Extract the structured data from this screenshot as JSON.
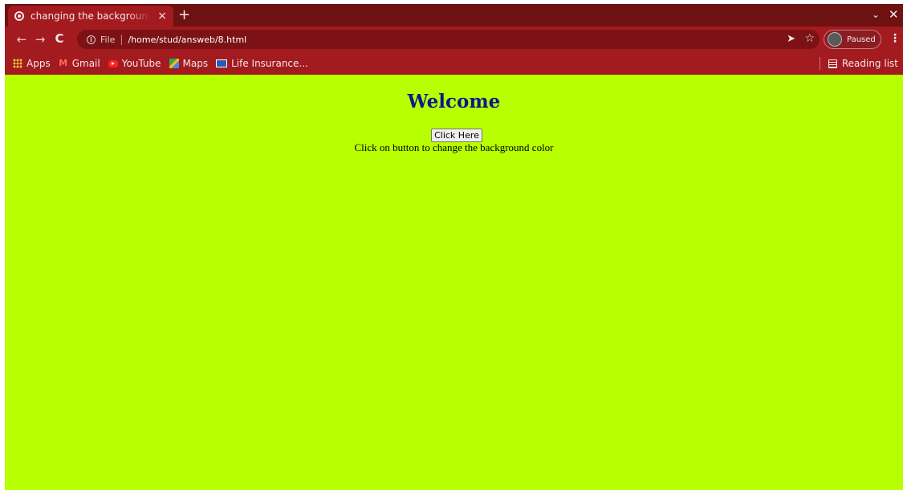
{
  "browser": {
    "tab": {
      "title": "changing the background color",
      "close": "×"
    },
    "new_tab": "+",
    "tab_dropdown": "⌄",
    "window_close": "✕",
    "nav": {
      "back": "←",
      "forward": "→",
      "reload": "C"
    },
    "omnibox": {
      "scheme_label": "File",
      "separator": "|",
      "url": "/home/stud/answeb/8.html"
    },
    "profile": {
      "status": "Paused"
    },
    "menu": "⋮",
    "bookmarks": [
      {
        "label": "Apps",
        "icon": "apps-grid-icon"
      },
      {
        "label": "Gmail",
        "icon": "gmail-icon"
      },
      {
        "label": "YouTube",
        "icon": "youtube-icon"
      },
      {
        "label": "Maps",
        "icon": "maps-icon"
      },
      {
        "label": "Life Insurance...",
        "icon": "life-insurance-icon"
      }
    ],
    "reading_list": "Reading list",
    "theme_color": "#a31a1f"
  },
  "page": {
    "heading": "Welcome",
    "button_label": "Click Here",
    "instruction": "Click on button to change the background color",
    "background_color": "#b8ff00",
    "heading_color": "#0a1a8c"
  }
}
